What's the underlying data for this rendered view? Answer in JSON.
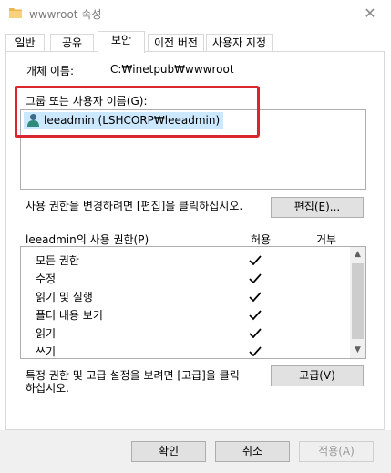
{
  "window": {
    "title": "wwwroot 속성",
    "close_glyph": "✕"
  },
  "tabs": [
    {
      "label": "일반"
    },
    {
      "label": "공유"
    },
    {
      "label": "보안"
    },
    {
      "label": "이전 버전"
    },
    {
      "label": "사용자 지정"
    }
  ],
  "security": {
    "object_name_label": "개체 이름:",
    "object_name_value": "C:₩inetpub₩wwwroot",
    "groups_label": "그룹 또는 사용자 이름(G):",
    "groups": [
      {
        "name": "leeadmin (LSHCORP₩leeadmin)"
      }
    ],
    "change_hint": "사용 권한을 변경하려면 [편집]을 클릭하십시오.",
    "edit_button": "편집(E)...",
    "permissions_label": "leeadmin의 사용 권한(P)",
    "allow_header": "허용",
    "deny_header": "거부",
    "permissions": [
      {
        "name": "모든 권한",
        "allow": true,
        "deny": false
      },
      {
        "name": "수정",
        "allow": true,
        "deny": false
      },
      {
        "name": "읽기 및 실행",
        "allow": true,
        "deny": false
      },
      {
        "name": "폴더 내용 보기",
        "allow": true,
        "deny": false
      },
      {
        "name": "읽기",
        "allow": true,
        "deny": false
      },
      {
        "name": "쓰기",
        "allow": true,
        "deny": false
      }
    ],
    "advanced_hint_line1": "특정 권한 및 고급 설정을 보려면 [고급]을 클릭",
    "advanced_hint_line2": "하십시오.",
    "advanced_button": "고급(V)"
  },
  "footer": {
    "ok_button": "확인",
    "cancel_button": "취소",
    "apply_button": "적용(A)"
  },
  "colors": {
    "highlight_border": "#d9262e",
    "selection": "#cce8ff"
  }
}
